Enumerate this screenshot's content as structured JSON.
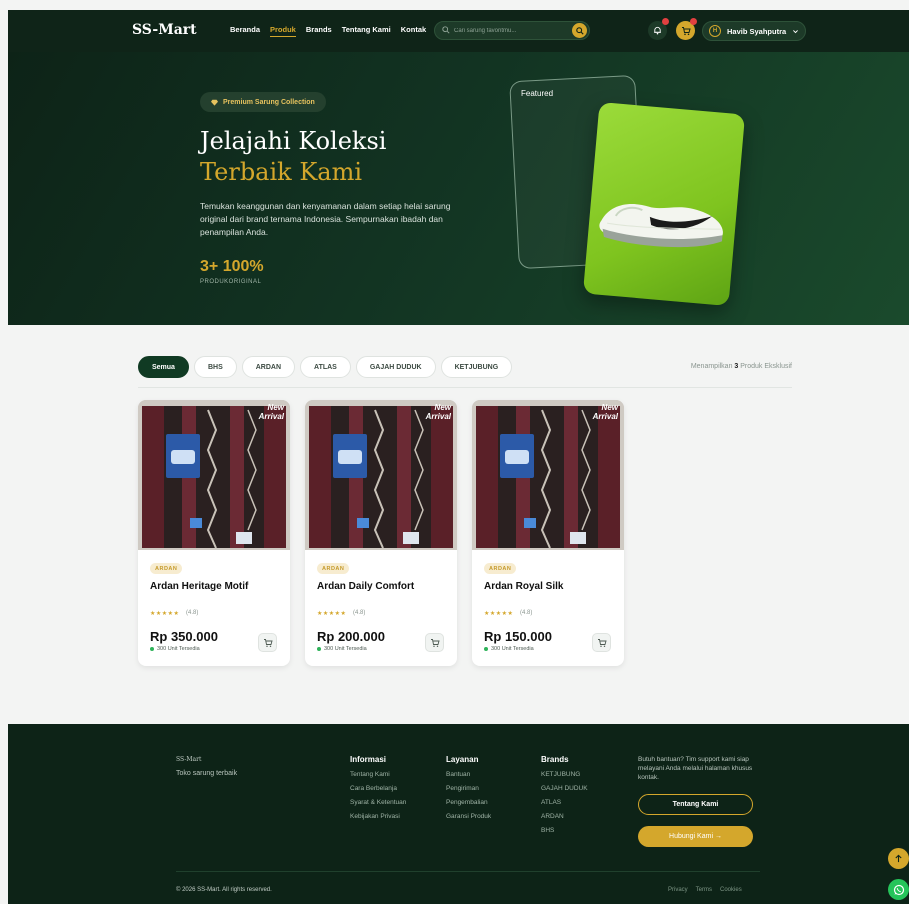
{
  "nav": {
    "brand": "SS-Mart",
    "links": [
      "Beranda",
      "Produk",
      "Brands",
      "Tentang Kami",
      "Kontak"
    ],
    "active_link": "Produk",
    "search_placeholder": "Cari sarung favoritmu...",
    "user_initial": "H",
    "user_name": "Havib Syahputra"
  },
  "hero": {
    "pill": "Premium Sarung Collection",
    "title_line1": "Jelajahi Koleksi",
    "title_line2": "Terbaik Kami",
    "description": "Temukan keanggunan dan kenyamanan dalam setiap helai sarung original dari brand ternama Indonesia. Sempurnakan ibadah dan penampilan Anda.",
    "stat_value": "3+ 100%",
    "stat_label": "PRODUKORIGINAL",
    "featured_label": "Featured"
  },
  "filters": {
    "chips": [
      "Semua",
      "BHS",
      "ARDAN",
      "ATLAS",
      "GAJAH DUDUK",
      "KETJUBUNG"
    ],
    "active": "Semua",
    "showing_prefix": "Menampilkan ",
    "showing_count": "3",
    "showing_suffix": " Produk Eksklusif"
  },
  "products": [
    {
      "badge": "New Arrival",
      "brand": "ARDAN",
      "name": "Ardan Heritage Motif",
      "stars": "★★★★★",
      "rating": "(4.8)",
      "price": "Rp 350.000",
      "stock": "300 Unit Tersedia"
    },
    {
      "badge": "New Arrival",
      "brand": "ARDAN",
      "name": "Ardan Daily Comfort",
      "stars": "★★★★★",
      "rating": "(4.8)",
      "price": "Rp 200.000",
      "stock": "300 Unit Tersedia"
    },
    {
      "badge": "New Arrival",
      "brand": "ARDAN",
      "name": "Ardan Royal Silk",
      "stars": "★★★★★",
      "rating": "(4.8)",
      "price": "Rp 150.000",
      "stock": "300 Unit Tersedia"
    }
  ],
  "footer": {
    "brand": "SS-Mart",
    "tagline": "Toko sarung terbaik",
    "informasi": {
      "title": "Informasi",
      "items": [
        "Tentang Kami",
        "Cara Berbelanja",
        "Syarat & Ketentuan",
        "Kebijakan Privasi"
      ]
    },
    "layanan": {
      "title": "Layanan",
      "items": [
        "Bantuan",
        "Pengiriman",
        "Pengembalian",
        "Garansi Produk"
      ]
    },
    "brands": {
      "title": "Brands",
      "items": [
        "KETJUBUNG",
        "GAJAH DUDUK",
        "ATLAS",
        "ARDAN",
        "BHS"
      ]
    },
    "help_text": "Butuh bantuan? Tim support kami siap melayani Anda melalui halaman khusus kontak.",
    "btn_about": "Tentang Kami",
    "btn_contact": "Hubungi Kami →",
    "copyright": "© 2026 SS-Mart. All rights reserved.",
    "links": [
      "Privacy",
      "Terms",
      "Cookies"
    ]
  },
  "colors": {
    "accent": "#d4a72c",
    "dark_green": "#0f2418",
    "whatsapp": "#25c45a"
  }
}
